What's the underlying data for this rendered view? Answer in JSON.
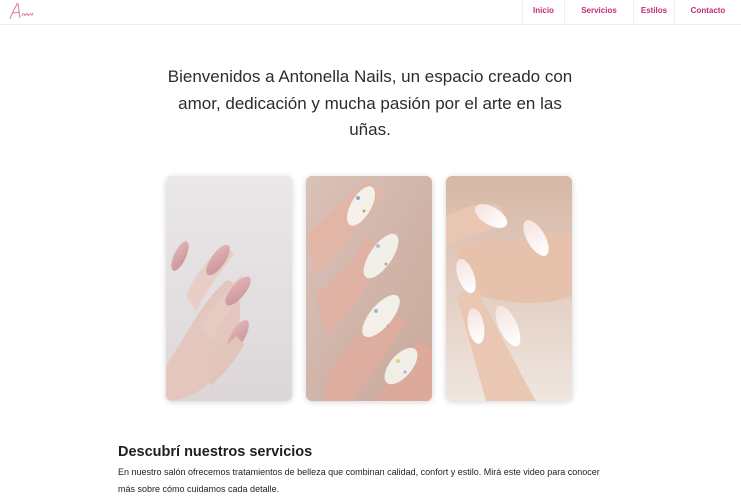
{
  "nav": {
    "logo_icon": "script-signature-logo",
    "items": [
      {
        "label": "Inicio"
      },
      {
        "label": "Servicios"
      },
      {
        "label": "Estilos"
      },
      {
        "label": "Contacto"
      }
    ],
    "color": "#c22c79"
  },
  "hero": {
    "text": "Bienvenidos a Antonella Nails, un espacio creado con amor, dedicación y mucha pasión por el arte en las uñas."
  },
  "gallery": {
    "images": [
      {
        "icon": "nude-almond-nails-photo"
      },
      {
        "icon": "glitter-white-nails-photo"
      },
      {
        "icon": "french-ombre-nails-photo"
      }
    ]
  },
  "services": {
    "title": "Descubrí nuestros servicios",
    "description": "En nuestro salón ofrecemos tratamientos de belleza que combinan calidad, confort y estilo. Mirá este video para conocer más sobre cómo cuidamos cada detalle."
  }
}
